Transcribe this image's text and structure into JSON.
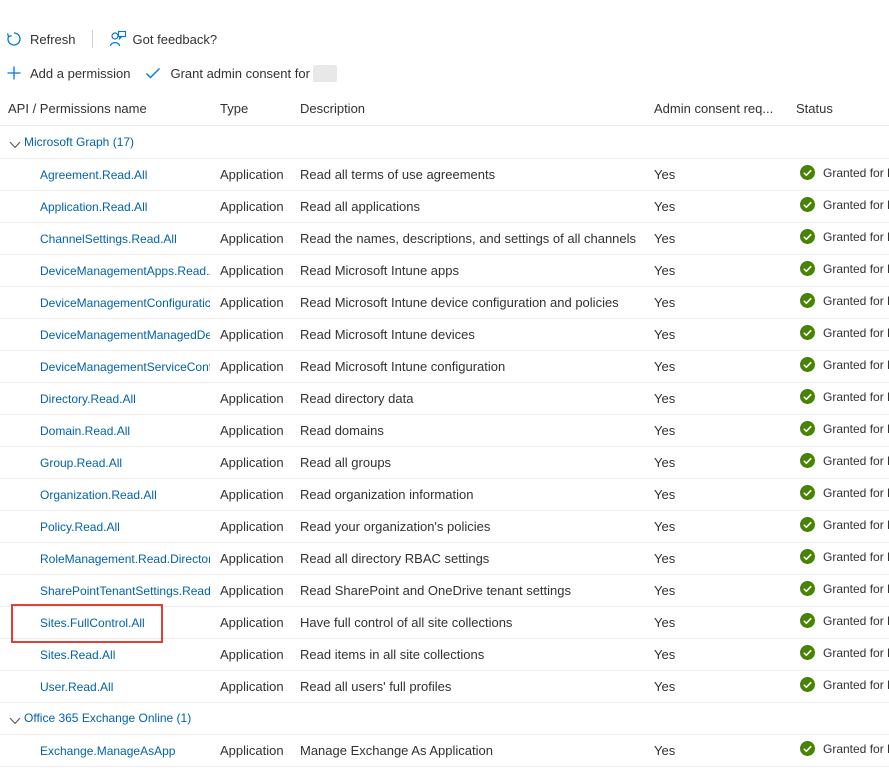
{
  "toolbar": {
    "refresh_label": "Refresh",
    "feedback_label": "Got feedback?",
    "add_permission_label": "Add a permission",
    "grant_consent_label": "Grant admin consent for"
  },
  "table": {
    "headers": {
      "name": "API / Permissions name",
      "type": "Type",
      "description": "Description",
      "consent": "Admin consent req...",
      "status": "Status"
    },
    "groups": [
      {
        "label": "Microsoft Graph (17)",
        "rows": [
          {
            "name": "Agreement.Read.All",
            "type": "Application",
            "description": "Read all terms of use agreements",
            "consent": "Yes",
            "status": "Granted for F"
          },
          {
            "name": "Application.Read.All",
            "type": "Application",
            "description": "Read all applications",
            "consent": "Yes",
            "status": "Granted for F"
          },
          {
            "name": "ChannelSettings.Read.All",
            "type": "Application",
            "description": "Read the names, descriptions, and settings of all channels",
            "consent": "Yes",
            "status": "Granted for F"
          },
          {
            "name": "DeviceManagementApps.Read.A",
            "type": "Application",
            "description": "Read Microsoft Intune apps",
            "consent": "Yes",
            "status": "Granted for F"
          },
          {
            "name": "DeviceManagementConfiguratic",
            "type": "Application",
            "description": "Read Microsoft Intune device configuration and policies",
            "consent": "Yes",
            "status": "Granted for F"
          },
          {
            "name": "DeviceManagementManagedDe",
            "type": "Application",
            "description": "Read Microsoft Intune devices",
            "consent": "Yes",
            "status": "Granted for F"
          },
          {
            "name": "DeviceManagementServiceConf",
            "type": "Application",
            "description": "Read Microsoft Intune configuration",
            "consent": "Yes",
            "status": "Granted for F"
          },
          {
            "name": "Directory.Read.All",
            "type": "Application",
            "description": "Read directory data",
            "consent": "Yes",
            "status": "Granted for F"
          },
          {
            "name": "Domain.Read.All",
            "type": "Application",
            "description": "Read domains",
            "consent": "Yes",
            "status": "Granted for F"
          },
          {
            "name": "Group.Read.All",
            "type": "Application",
            "description": "Read all groups",
            "consent": "Yes",
            "status": "Granted for F"
          },
          {
            "name": "Organization.Read.All",
            "type": "Application",
            "description": "Read organization information",
            "consent": "Yes",
            "status": "Granted for F"
          },
          {
            "name": "Policy.Read.All",
            "type": "Application",
            "description": "Read your organization's policies",
            "consent": "Yes",
            "status": "Granted for F"
          },
          {
            "name": "RoleManagement.Read.Directory",
            "type": "Application",
            "description": "Read all directory RBAC settings",
            "consent": "Yes",
            "status": "Granted for F"
          },
          {
            "name": "SharePointTenantSettings.Read.A",
            "type": "Application",
            "description": "Read SharePoint and OneDrive tenant settings",
            "consent": "Yes",
            "status": "Granted for F"
          },
          {
            "name": "Sites.FullControl.All",
            "type": "Application",
            "description": "Have full control of all site collections",
            "consent": "Yes",
            "status": "Granted for F"
          },
          {
            "name": "Sites.Read.All",
            "type": "Application",
            "description": "Read items in all site collections",
            "consent": "Yes",
            "status": "Granted for F"
          },
          {
            "name": "User.Read.All",
            "type": "Application",
            "description": "Read all users' full profiles",
            "consent": "Yes",
            "status": "Granted for F"
          }
        ]
      },
      {
        "label": "Office 365 Exchange Online (1)",
        "rows": [
          {
            "name": "Exchange.ManageAsApp",
            "type": "Application",
            "description": "Manage Exchange As Application",
            "consent": "Yes",
            "status": "Granted for F"
          }
        ]
      }
    ]
  },
  "colors": {
    "link": "#0062ad",
    "granted": "#498205",
    "highlight": "#e0403a"
  }
}
